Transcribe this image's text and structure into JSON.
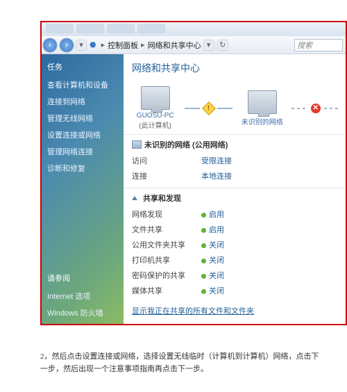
{
  "toolbar": {
    "crumb1": "控制面板",
    "crumb2": "网络和共享中心",
    "search_placeholder": "搜索"
  },
  "sidebar": {
    "tasks_header": "任务",
    "items": [
      "查看计算机和设备",
      "连接到网络",
      "管理无线网络",
      "设置连接或网络",
      "管理网络连接",
      "诊断和修复"
    ],
    "footer_header": "请参阅",
    "footer_items": [
      "Internet 选项",
      "Windows 防火墙"
    ]
  },
  "main": {
    "title": "网络和共享中心",
    "map": {
      "pc_name": "GUOSU-PC",
      "pc_sub": "(此计算机)",
      "unknown": "未识别的网络"
    },
    "net_section": {
      "title": "未识别的网络 (公用网络)",
      "rows": [
        {
          "k": "访问",
          "v": "受限连接"
        },
        {
          "k": "连接",
          "v": "本地连接"
        }
      ]
    },
    "share_section": {
      "title": "共享和发现",
      "rows": [
        {
          "k": "网络发现",
          "v": "启用",
          "on": true
        },
        {
          "k": "文件共享",
          "v": "启用",
          "on": true
        },
        {
          "k": "公用文件夹共享",
          "v": "关闭",
          "on": true
        },
        {
          "k": "打印机共享",
          "v": "关闭",
          "on": true
        },
        {
          "k": "密码保护的共享",
          "v": "关闭",
          "on": true
        },
        {
          "k": "媒体共享",
          "v": "关闭",
          "on": true
        }
      ]
    },
    "footer_link": "显示我正在共享的所有文件和文件夹"
  },
  "caption": "2，然后点击设置连接或网络，选择设置无线临时（计算机到计算机）网络，点击下一步，然后出现一个注意事项指南再点击下一步。"
}
